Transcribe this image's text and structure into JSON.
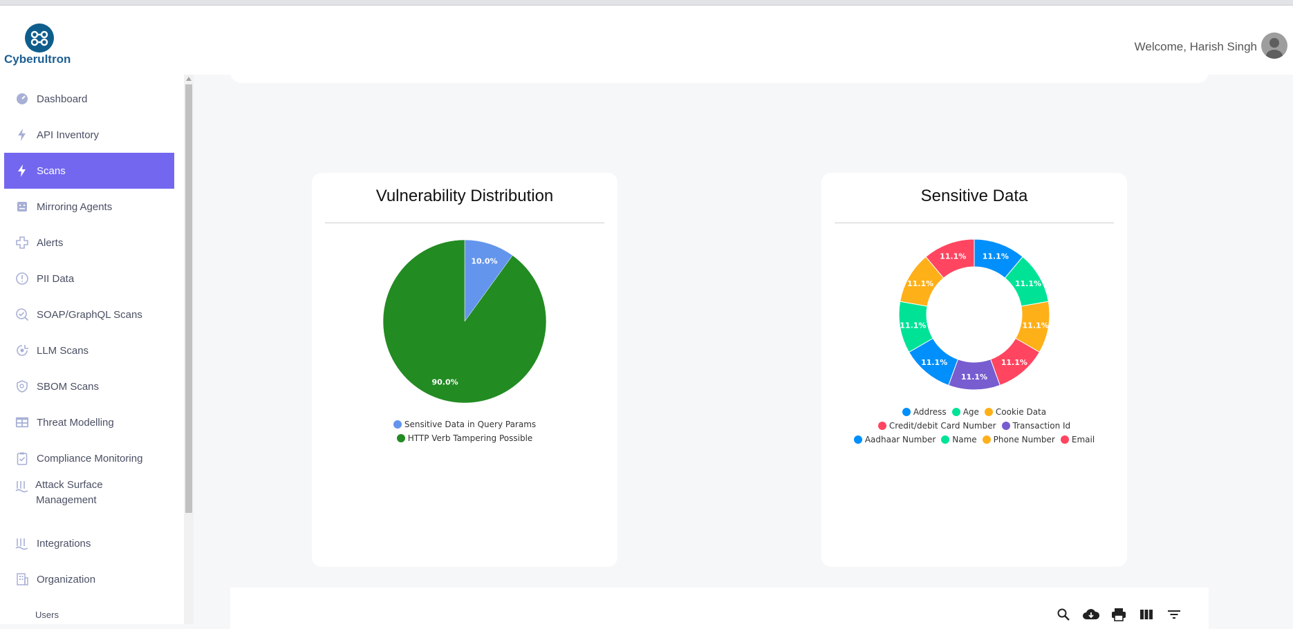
{
  "header": {
    "brand": "Cyberultron",
    "welcome": "Welcome, Harish Singh"
  },
  "sidebar": {
    "items": [
      {
        "label": "Dashboard",
        "icon": "dashboard-icon"
      },
      {
        "label": "API Inventory",
        "icon": "bolt-icon"
      },
      {
        "label": "Scans",
        "icon": "bolt-icon",
        "active": true
      },
      {
        "label": "Mirroring Agents",
        "icon": "robot-icon"
      },
      {
        "label": "Alerts",
        "icon": "alert-icon"
      },
      {
        "label": "PII Data",
        "icon": "info-circle-icon"
      },
      {
        "label": "SOAP/GraphQL Scans",
        "icon": "search-check-icon"
      },
      {
        "label": "LLM Scans",
        "icon": "llm-icon"
      },
      {
        "label": "SBOM Scans",
        "icon": "shield-icon"
      },
      {
        "label": "Threat Modelling",
        "icon": "table-icon"
      },
      {
        "label": "Compliance Monitoring",
        "icon": "clipboard-check-icon"
      },
      {
        "label": "Attack Surface",
        "label2": "Management",
        "icon": "attack-surface-icon"
      },
      {
        "label": "Integrations",
        "icon": "integrations-icon"
      },
      {
        "label": "Organization",
        "icon": "building-icon"
      }
    ],
    "sub_item": "Users"
  },
  "charts": {
    "vulnerability": {
      "title": "Vulnerability Distribution"
    },
    "sensitive": {
      "title": "Sensitive Data"
    }
  },
  "chart_data": [
    {
      "type": "pie",
      "title": "Vulnerability Distribution",
      "categories": [
        "Sensitive Data in Query Params",
        "HTTP Verb Tampering Possible"
      ],
      "values": [
        10.0,
        90.0
      ],
      "labels": [
        "10.0%",
        "90.0%"
      ],
      "colors": [
        "#6495ed",
        "#228b22"
      ],
      "legend": "bottom"
    },
    {
      "type": "pie",
      "donut": true,
      "title": "Sensitive Data",
      "categories": [
        "Address",
        "Age",
        "Cookie Data",
        "Credit/debit Card Number",
        "Transaction Id",
        "Aadhaar Number",
        "Name",
        "Phone Number",
        "Email"
      ],
      "values": [
        11.1,
        11.1,
        11.1,
        11.1,
        11.1,
        11.1,
        11.1,
        11.1,
        11.1
      ],
      "labels": [
        "11.1%",
        "11.1%",
        "11.1%",
        "11.1%",
        "11.1%",
        "11.1%",
        "11.1%",
        "11.1%",
        "11.1%"
      ],
      "colors": [
        "#008ffb",
        "#00e396",
        "#feb019",
        "#ff4560",
        "#775dd0",
        "#008ffb",
        "#00e396",
        "#feb019",
        "#ff4560"
      ],
      "legend": "bottom"
    }
  ],
  "toolbar": {
    "icons": [
      "search-icon",
      "download-icon",
      "print-icon",
      "columns-icon",
      "filter-icon"
    ]
  }
}
